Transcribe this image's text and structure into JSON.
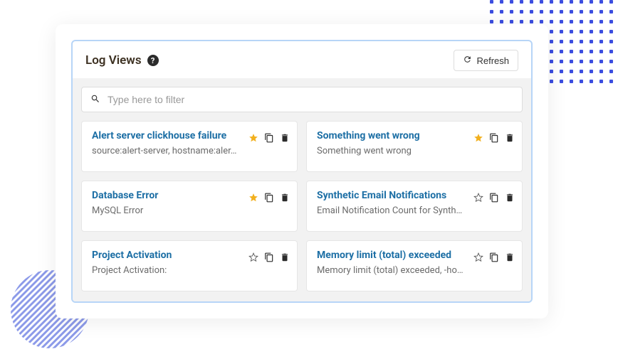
{
  "header": {
    "title": "Log Views",
    "refresh_label": "Refresh"
  },
  "filter": {
    "placeholder": "Type here to filter"
  },
  "cards": [
    {
      "title": "Alert server clickhouse failure",
      "subtitle": "source:alert-server, hostname:aler…",
      "starred": true
    },
    {
      "title": "Something went wrong",
      "subtitle": "Something went wrong",
      "starred": true
    },
    {
      "title": "Database Error",
      "subtitle": "MySQL Error",
      "starred": true
    },
    {
      "title": "Synthetic Email Notifications",
      "subtitle": "Email Notification Count for Synth…",
      "starred": false
    },
    {
      "title": "Project Activation",
      "subtitle": "Project Activation:",
      "starred": false
    },
    {
      "title": "Memory limit (total) exceeded",
      "subtitle": "Memory limit (total) exceeded, -ho…",
      "starred": false
    }
  ]
}
